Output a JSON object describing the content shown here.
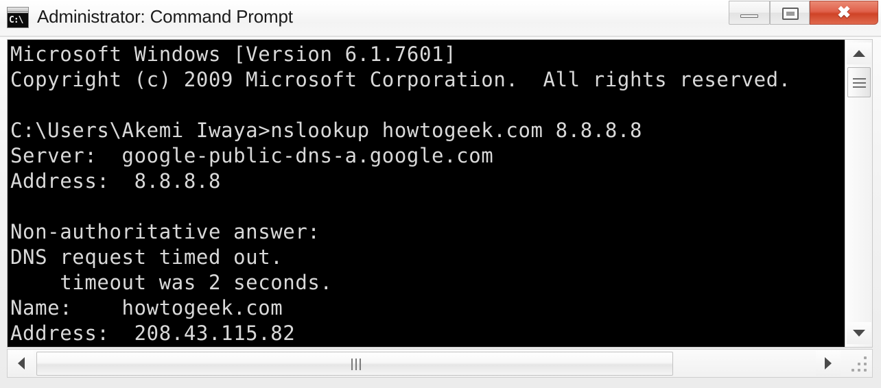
{
  "window": {
    "title": "Administrator: Command Prompt",
    "icon": "cmd-console-icon",
    "icon_glyph": "C:\\",
    "accent_close": "#cf4327",
    "console_bg": "#000000",
    "console_fg": "#d9d9d9"
  },
  "titlebar_buttons": {
    "minimize": {
      "name": "minimize-button",
      "glyph": "–"
    },
    "maximize": {
      "name": "restore-button",
      "glyph": "□"
    },
    "close": {
      "name": "close-button",
      "glyph": "✖"
    }
  },
  "console": {
    "lines": [
      "Microsoft Windows [Version 6.1.7601]",
      "Copyright (c) 2009 Microsoft Corporation.  All rights reserved.",
      "",
      "C:\\Users\\Akemi Iwaya>nslookup howtogeek.com 8.8.8.8",
      "Server:  google-public-dns-a.google.com",
      "Address:  8.8.8.8",
      "",
      "Non-authoritative answer:",
      "DNS request timed out.",
      "    timeout was 2 seconds.",
      "Name:    howtogeek.com",
      "Address:  208.43.115.82"
    ]
  },
  "scrollbars": {
    "vertical": {
      "up_arrow": "▲",
      "down_arrow": "▼",
      "thumb_position_percent": 8
    },
    "horizontal": {
      "left_arrow": "◀",
      "right_arrow": "▶",
      "thumb_position_percent": 0
    }
  }
}
